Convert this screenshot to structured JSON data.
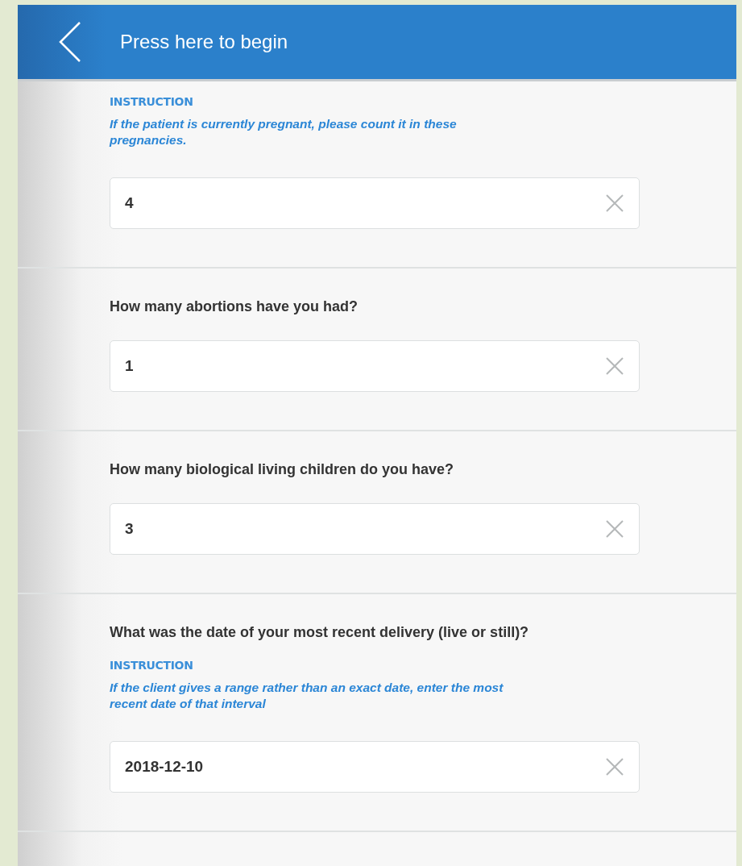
{
  "header": {
    "title": "Press here to begin"
  },
  "sections": [
    {
      "instruction": {
        "label": "INSTRUCTION",
        "text": "If the patient is currently pregnant, please count it in these pregnancies."
      },
      "value": "4"
    },
    {
      "question": "How many abortions have you had?",
      "value": "1"
    },
    {
      "question": "How many biological living children do you have?",
      "value": "3"
    },
    {
      "question": "What was the date of your most recent delivery (live or still)?",
      "instruction": {
        "label": "INSTRUCTION",
        "text": "If the client gives a range rather than an exact date, enter the most recent date of that interval"
      },
      "value": "2018-12-10"
    }
  ]
}
